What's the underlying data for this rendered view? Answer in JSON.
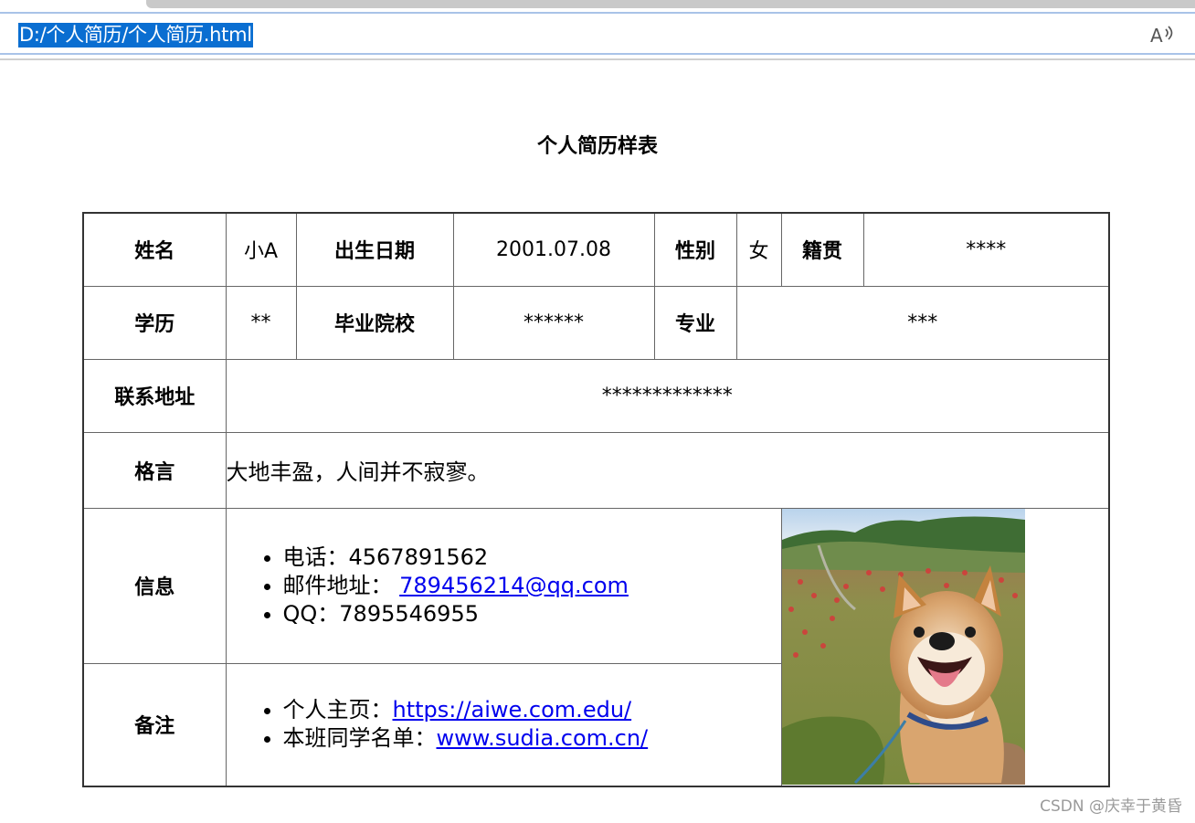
{
  "browser": {
    "url": "D:/个人简历/个人简历.html",
    "read_aloud_icon": "read-aloud-icon"
  },
  "page": {
    "title": "个人简历样表"
  },
  "resume": {
    "row1": {
      "name_label": "姓名",
      "name_value": "小A",
      "birth_label": "出生日期",
      "birth_value": "2001.07.08",
      "gender_label": "性别",
      "gender_value": "女",
      "origin_label": "籍贯",
      "origin_value": "****"
    },
    "row2": {
      "edu_label": "学历",
      "edu_value": "**",
      "school_label": "毕业院校",
      "school_value": "******",
      "major_label": "专业",
      "major_value": "***"
    },
    "row3": {
      "address_label": "联系地址",
      "address_value": "*************"
    },
    "row4": {
      "motto_label": "格言",
      "motto_value": "大地丰盈，人间并不寂寥。"
    },
    "info": {
      "label": "信息",
      "phone_prefix": "电话：",
      "phone": "4567891562",
      "email_prefix": "邮件地址：",
      "email": "789456214@qq.com",
      "qq_prefix": "QQ：",
      "qq": "7895546955"
    },
    "notes": {
      "label": "备注",
      "homepage_prefix": "个人主页：",
      "homepage_link": "https://aiwe.com.edu/",
      "classmates_prefix": "本班同学名单：",
      "classmates_link": "www.sudia.com.cn/"
    },
    "photo_icon": "shiba-dog-photo"
  },
  "watermark": "CSDN @庆幸于黄昏"
}
